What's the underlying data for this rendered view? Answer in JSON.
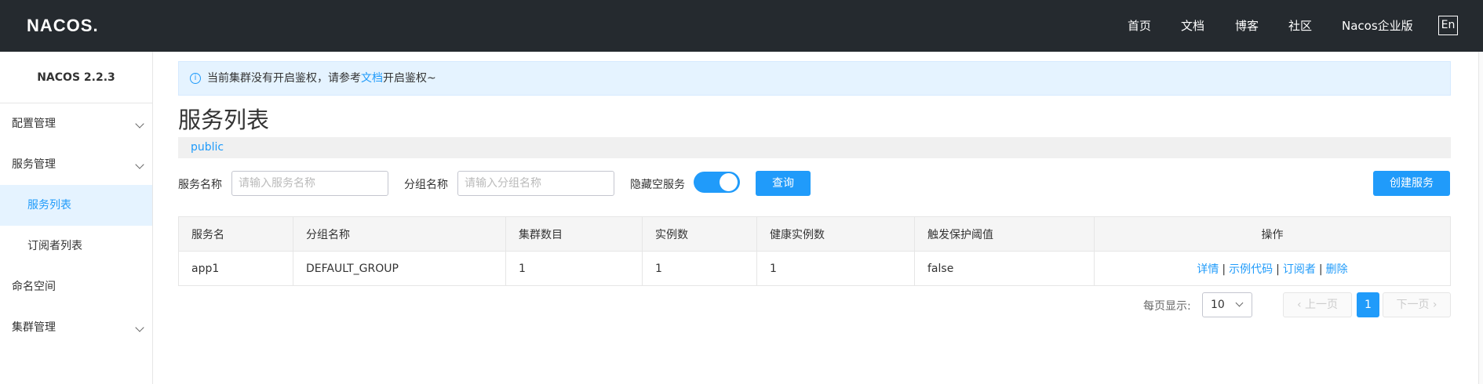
{
  "header": {
    "logo": "NACOS.",
    "nav": [
      "首页",
      "文档",
      "博客",
      "社区",
      "Nacos企业版"
    ],
    "lang": "En"
  },
  "sidebar": {
    "title": "NACOS 2.2.3",
    "items": [
      {
        "label": "配置管理",
        "expandable": true
      },
      {
        "label": "服务管理",
        "expandable": true
      },
      {
        "label": "服务列表",
        "sub": true,
        "active": true
      },
      {
        "label": "订阅者列表",
        "sub": true
      },
      {
        "label": "命名空间"
      },
      {
        "label": "集群管理",
        "expandable": true
      }
    ]
  },
  "notice": {
    "prefix": "当前集群没有开启鉴权，请参考",
    "link": "文档",
    "suffix": "开启鉴权~"
  },
  "page_title": "服务列表",
  "namespace": "public",
  "filters": {
    "service_label": "服务名称",
    "service_placeholder": "请输入服务名称",
    "group_label": "分组名称",
    "group_placeholder": "请输入分组名称",
    "hide_empty_label": "隐藏空服务",
    "hide_empty_on": true,
    "query_button": "查询",
    "create_button": "创建服务"
  },
  "table": {
    "headers": [
      "服务名",
      "分组名称",
      "集群数目",
      "实例数",
      "健康实例数",
      "触发保护阈值",
      "操作"
    ],
    "rows": [
      {
        "cells": [
          "app1",
          "DEFAULT_GROUP",
          "1",
          "1",
          "1",
          "false"
        ],
        "actions": [
          "详情",
          "示例代码",
          "订阅者",
          "删除"
        ]
      }
    ],
    "action_separator": "|"
  },
  "pagination": {
    "page_size_label": "每页显示:",
    "page_size": "10",
    "prev": "上一页",
    "current": "1",
    "next": "下一页"
  },
  "colors": {
    "accent": "#209bfa",
    "header_bg": "#252a2f"
  }
}
